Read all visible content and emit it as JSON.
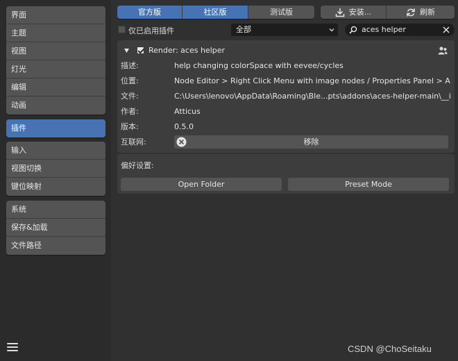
{
  "sidebar": {
    "groups": [
      [
        "界面",
        "主题",
        "视图",
        "灯光",
        "编辑",
        "动画"
      ],
      [
        "插件"
      ],
      [
        "输入",
        "视图切换",
        "键位映射"
      ],
      [
        "系统",
        "保存&加载",
        "文件路径"
      ]
    ]
  },
  "topbar": {
    "tabs": [
      "官方版",
      "社区版",
      "测试版"
    ],
    "install_label": "安装...",
    "refresh_label": "刷新"
  },
  "filter": {
    "enabled_only_label": "仅已启用插件",
    "category_value": "全部",
    "search_value": "aces helper"
  },
  "addon": {
    "title": "Render: aces helper",
    "labels": {
      "description": "描述:",
      "location": "位置:",
      "file": "文件:",
      "author": "作者:",
      "version": "版本:",
      "internet": "互联网:"
    },
    "description": "help changing colorSpace with eevee/cycles",
    "location": "Node Editor > Right Click Menu with image nodes / Properties Panel > ACES H...",
    "file": "C:\\Users\\lenovo\\AppData\\Roaming\\Ble...pts\\addons\\aces-helper-main\\__init__.py",
    "author": "Atticus",
    "version": "0.5.0",
    "remove_label": "移除"
  },
  "preferences": {
    "title": "偏好设置:",
    "open_folder_label": "Open Folder",
    "preset_mode_label": "Preset Mode"
  },
  "watermark": "CSDN @ChoSeitaku",
  "colors": {
    "accent": "#4772b3",
    "background": "#303030",
    "sidebar": "#2b2b2b",
    "button": "#545454",
    "field": "#1d1d1d"
  }
}
